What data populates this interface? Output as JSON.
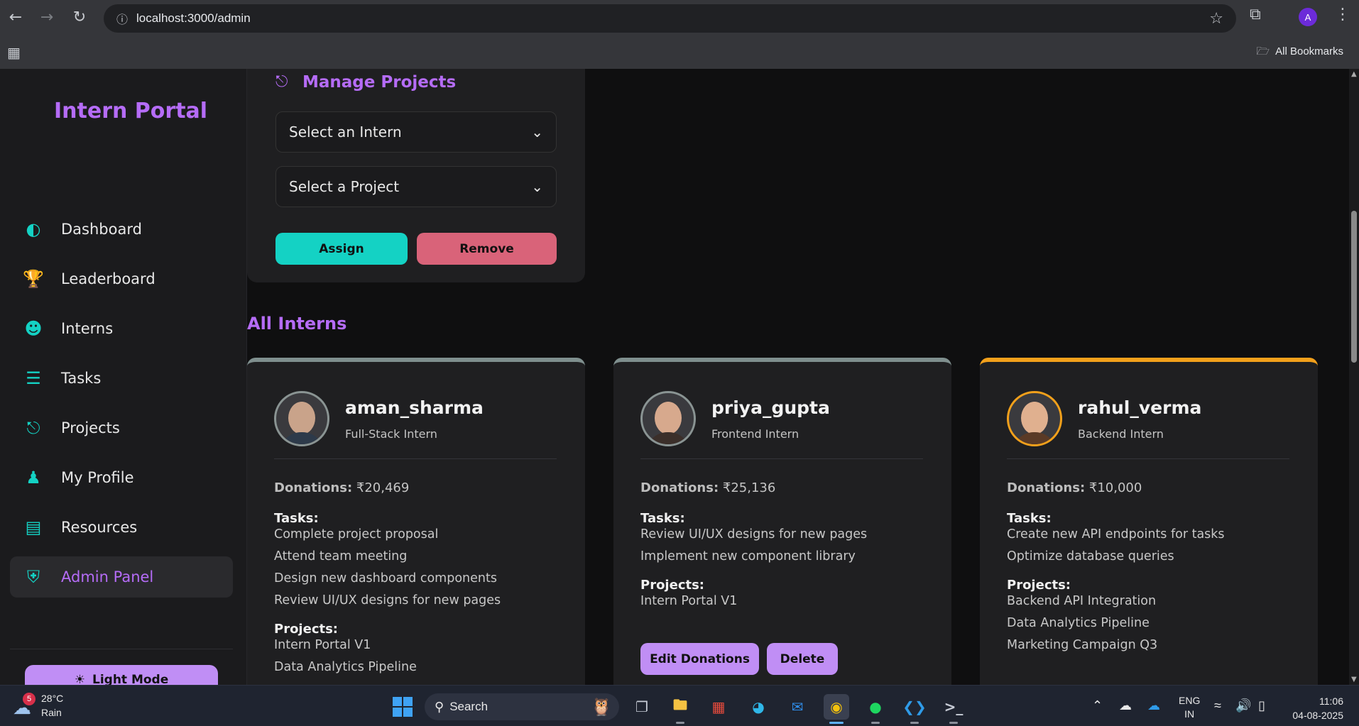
{
  "browser": {
    "url": "localhost:3000/admin",
    "all_bookmarks": "All Bookmarks",
    "profile_initial": "A"
  },
  "sidebar": {
    "brand": "Intern Portal",
    "items": [
      {
        "label": "Dashboard",
        "icon": "gauge-icon"
      },
      {
        "label": "Leaderboard",
        "icon": "trophy-icon"
      },
      {
        "label": "Interns",
        "icon": "users-icon"
      },
      {
        "label": "Tasks",
        "icon": "list-check-icon"
      },
      {
        "label": "Projects",
        "icon": "diagram-icon"
      },
      {
        "label": "My Profile",
        "icon": "user-icon"
      },
      {
        "label": "Resources",
        "icon": "book-icon"
      },
      {
        "label": "Admin Panel",
        "icon": "user-shield-icon",
        "active": true
      }
    ],
    "light_mode": "Light Mode"
  },
  "manage": {
    "title": "Manage Projects",
    "intern_select": "Select an Intern",
    "project_select": "Select a Project",
    "assign": "Assign",
    "remove": "Remove"
  },
  "section_title": "All Interns",
  "labels": {
    "donations": "Donations:",
    "tasks": "Tasks:",
    "projects": "Projects:"
  },
  "interns": [
    {
      "username": "aman_sharma",
      "role": "Full-Stack Intern",
      "donations": "₹20,469",
      "tasks": [
        "Complete project proposal",
        "Attend team meeting",
        "Design new dashboard components",
        "Review UI/UX designs for new pages"
      ],
      "projects": [
        "Intern Portal V1",
        "Data Analytics Pipeline"
      ]
    },
    {
      "username": "priya_gupta",
      "role": "Frontend Intern",
      "donations": "₹25,136",
      "tasks": [
        "Review UI/UX designs for new pages",
        "Implement new component library"
      ],
      "projects": [
        "Intern Portal V1"
      ],
      "edit_label": "Edit Donations",
      "delete_label": "Delete"
    },
    {
      "username": "rahul_verma",
      "role": "Backend Intern",
      "donations": "₹10,000",
      "tasks": [
        "Create new API endpoints for tasks",
        "Optimize database queries"
      ],
      "projects": [
        "Backend API Integration",
        "Data Analytics Pipeline",
        "Marketing Campaign Q3"
      ]
    }
  ],
  "taskbar": {
    "weather_temp": "28°C",
    "weather_desc": "Rain",
    "weather_badge": "5",
    "search": "Search",
    "lang_1": "ENG",
    "lang_2": "IN",
    "time": "11:06",
    "date": "04-08-2025"
  },
  "colors": {
    "accent": "#b56cf7",
    "teal": "#14d2c4",
    "danger": "#d96379",
    "button": "#c08ef5"
  }
}
